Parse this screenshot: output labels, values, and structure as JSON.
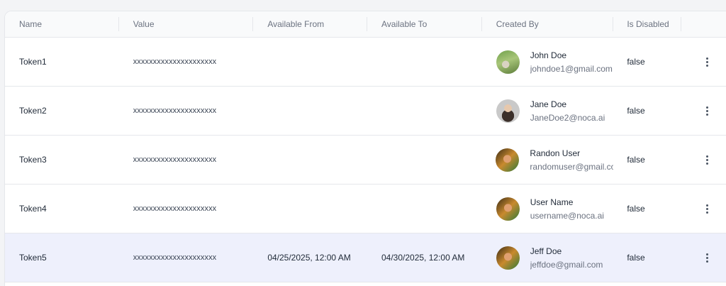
{
  "columns": {
    "name": "Name",
    "value": "Value",
    "available_from": "Available From",
    "available_to": "Available To",
    "created_by": "Created By",
    "is_disabled": "Is Disabled"
  },
  "rows": [
    {
      "name": "Token1",
      "value": "xxxxxxxxxxxxxxxxxxxxx",
      "from": "",
      "to": "",
      "creator_name": "John Doe",
      "creator_email": "johndoe1@gmail.com",
      "disabled": "false",
      "avatar": "nature-photo"
    },
    {
      "name": "Token2",
      "value": "xxxxxxxxxxxxxxxxxxxxx",
      "from": "",
      "to": "",
      "creator_name": "Jane Doe",
      "creator_email": "JaneDoe2@noca.ai",
      "disabled": "false",
      "avatar": "bearded-man-photo"
    },
    {
      "name": "Token3",
      "value": "xxxxxxxxxxxxxxxxxxxxx",
      "from": "",
      "to": "",
      "creator_name": "Randon User",
      "creator_email": "randomuser@gmail.co",
      "disabled": "false",
      "avatar": "woman-photo"
    },
    {
      "name": "Token4",
      "value": "xxxxxxxxxxxxxxxxxxxxx",
      "from": "",
      "to": "",
      "creator_name": "User Name",
      "creator_email": "username@noca.ai",
      "disabled": "false",
      "avatar": "woman-photo"
    },
    {
      "name": "Token5",
      "value": "xxxxxxxxxxxxxxxxxxxxx",
      "from": "04/25/2025, 12:00 AM",
      "to": "04/30/2025, 12:00 AM",
      "creator_name": "Jeff Doe",
      "creator_email": "jeffdoe@gmail.com",
      "disabled": "false",
      "avatar": "woman-photo",
      "selected": true
    }
  ],
  "icons": {
    "row_actions": "kebab-menu-icon"
  },
  "colors": {
    "selected_row_bg": "#eef0fc",
    "header_bg": "#f9fafb",
    "border": "#e5e7eb"
  }
}
